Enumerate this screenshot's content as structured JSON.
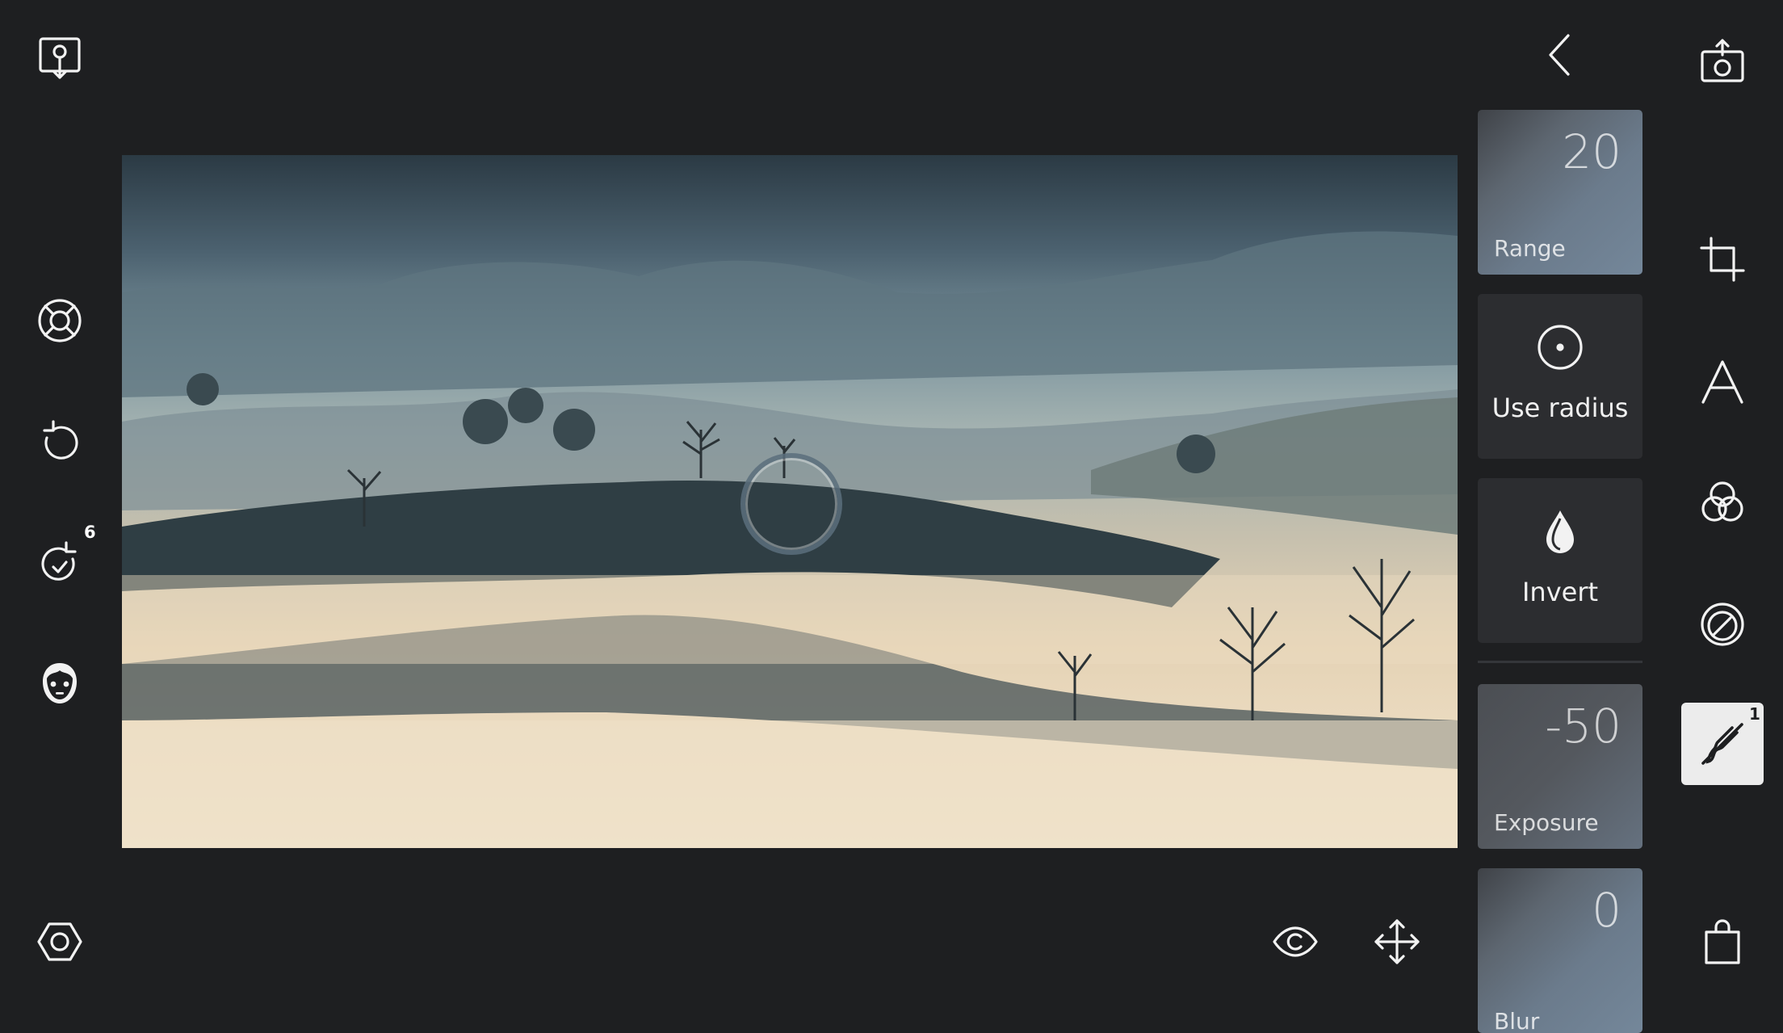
{
  "left_toolbar": {
    "import_icon": "import-photo-icon",
    "help_icon": "lifebuoy-icon",
    "undo_icon": "undo-icon",
    "redo_icon": "redo-icon",
    "redo_count": "6",
    "face_icon": "face-icon",
    "settings_icon": "settings-icon"
  },
  "right_toolbar": {
    "export_icon": "export-camera-icon",
    "crop_icon": "crop-icon",
    "text_icon": "text-icon",
    "filters_icon": "filters-icon",
    "vignette_icon": "vignette-icon",
    "brush_icon": "brush-icon",
    "brush_count": "1",
    "store_icon": "shopping-bag-icon"
  },
  "bottom_toolbar": {
    "preview_icon": "eye-icon",
    "move_icon": "move-icon"
  },
  "panel": {
    "back_icon": "back-chevron-icon",
    "range": {
      "value": "20",
      "label": "Range"
    },
    "use_radius": {
      "label": "Use radius"
    },
    "invert": {
      "label": "Invert"
    },
    "exposure": {
      "value": "-50",
      "label": "Exposure"
    },
    "blur": {
      "value": "0",
      "label": "Blur"
    }
  },
  "colors": {
    "background": "#1e1f21",
    "tile": "#2c2d30",
    "active_tool_bg": "#ececec"
  }
}
